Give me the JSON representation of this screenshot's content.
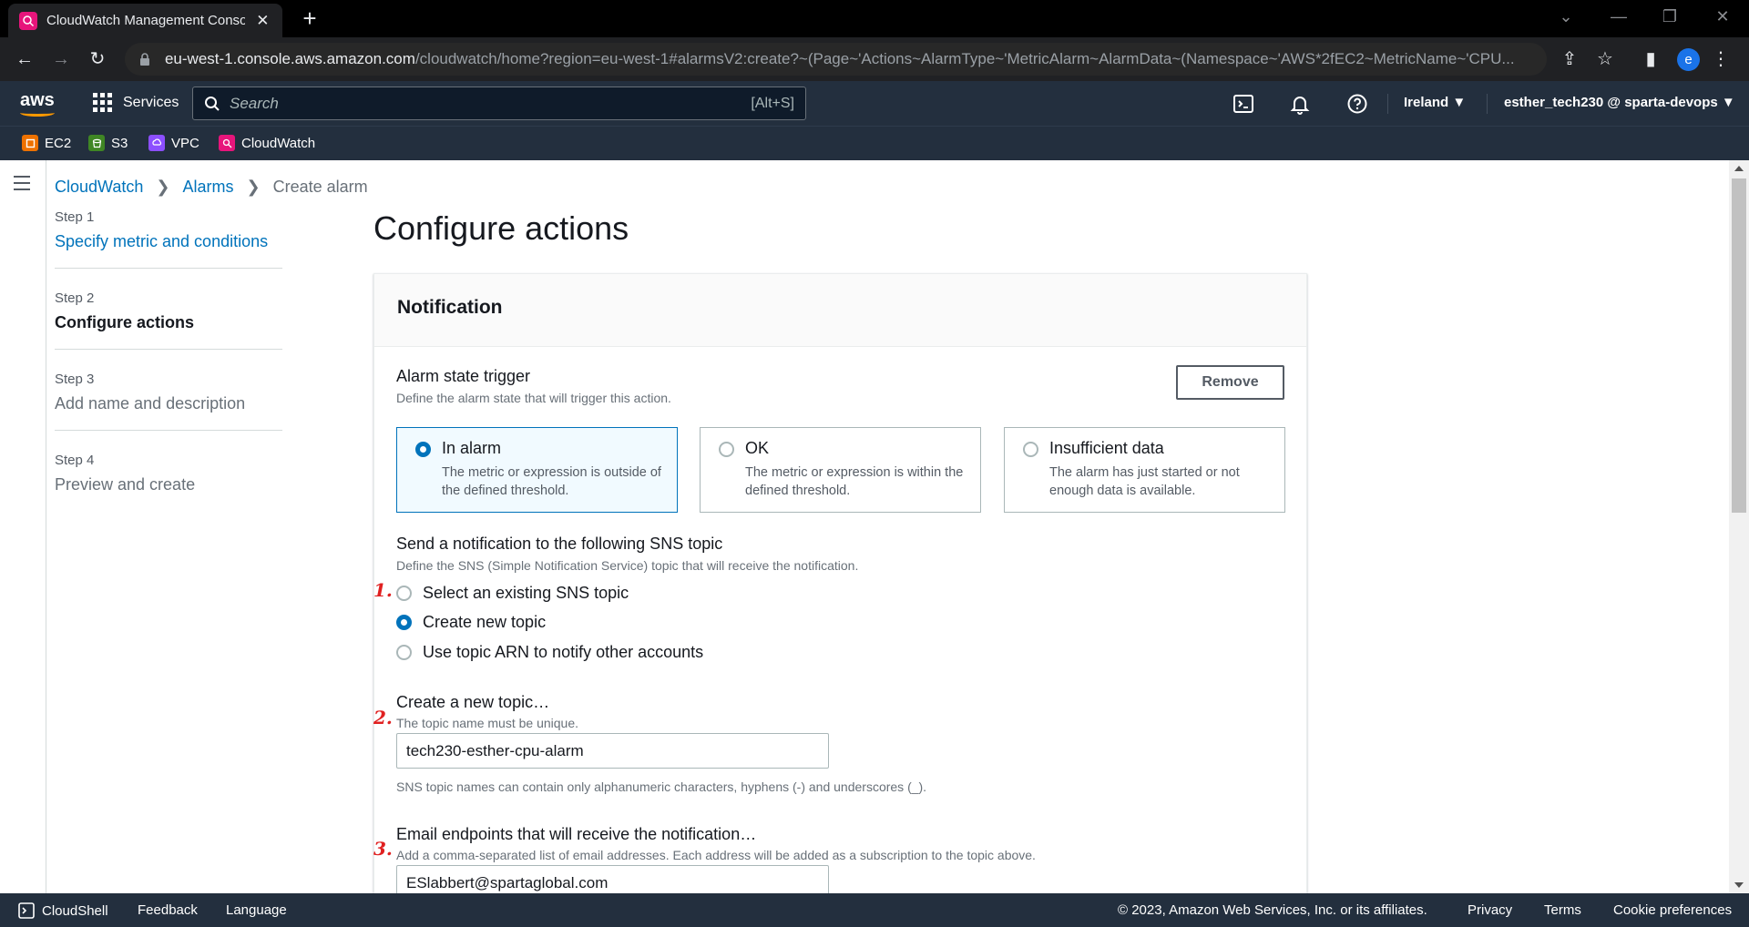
{
  "browser": {
    "tab_title": "CloudWatch Management Conso",
    "url_host": "eu-west-1.console.aws.amazon.com",
    "url_path": "/cloudwatch/home?region=eu-west-1#alarmsV2:create?~(Page~'Actions~AlarmType~'MetricAlarm~AlarmData~(Namespace~'AWS*2fEC2~MetricName~'CPU...",
    "profile_initial": "e"
  },
  "aws_header": {
    "logo": "aws",
    "services_label": "Services",
    "search_placeholder": "Search",
    "search_shortcut": "[Alt+S]",
    "region": "Ireland ▼",
    "account": "esther_tech230 @ sparta-devops ▼"
  },
  "favorites": [
    {
      "label": "EC2",
      "color": "#ed7100",
      "icon": "ec2-icon"
    },
    {
      "label": "S3",
      "color": "#3f8624",
      "icon": "s3-icon"
    },
    {
      "label": "VPC",
      "color": "#8c4fff",
      "icon": "vpc-icon"
    },
    {
      "label": "CloudWatch",
      "color": "#e7157b",
      "icon": "cloudwatch-icon"
    }
  ],
  "breadcrumb": {
    "items": [
      "CloudWatch",
      "Alarms"
    ],
    "current": "Create alarm"
  },
  "steps": [
    {
      "num": "Step 1",
      "label": "Specify metric and conditions"
    },
    {
      "num": "Step 2",
      "label": "Configure actions"
    },
    {
      "num": "Step 3",
      "label": "Add name and description"
    },
    {
      "num": "Step 4",
      "label": "Preview and create"
    }
  ],
  "page_title": "Configure actions",
  "notification": {
    "title": "Notification",
    "remove_label": "Remove",
    "trigger_label": "Alarm state trigger",
    "trigger_desc": "Define the alarm state that will trigger this action.",
    "tiles": [
      {
        "title": "In alarm",
        "desc": "The metric or expression is outside of the defined threshold."
      },
      {
        "title": "OK",
        "desc": "The metric or expression is within the defined threshold."
      },
      {
        "title": "Insufficient data",
        "desc": "The alarm has just started or not enough data is available."
      }
    ],
    "sns_label": "Send a notification to the following SNS topic",
    "sns_desc": "Define the SNS (Simple Notification Service) topic that will receive the notification.",
    "sns_options": [
      "Select an existing SNS topic",
      "Create new topic",
      "Use topic ARN to notify other accounts"
    ],
    "new_topic_label": "Create a new topic…",
    "new_topic_desc": "The topic name must be unique.",
    "topic_name_value": "tech230-esther-cpu-alarm",
    "topic_name_hint": "SNS topic names can contain only alphanumeric characters, hyphens (-) and underscores (_).",
    "email_label": "Email endpoints that will receive the notification…",
    "email_desc": "Add a comma-separated list of email addresses. Each address will be added as a subscription to the topic above.",
    "email_value": "ESlabbert@spartaglobal.com"
  },
  "annotations": [
    "1.",
    "2.",
    "3."
  ],
  "footer": {
    "cloudshell": "CloudShell",
    "feedback": "Feedback",
    "language": "Language",
    "copyright": "© 2023, Amazon Web Services, Inc. or its affiliates.",
    "privacy": "Privacy",
    "terms": "Terms",
    "cookies": "Cookie preferences"
  }
}
